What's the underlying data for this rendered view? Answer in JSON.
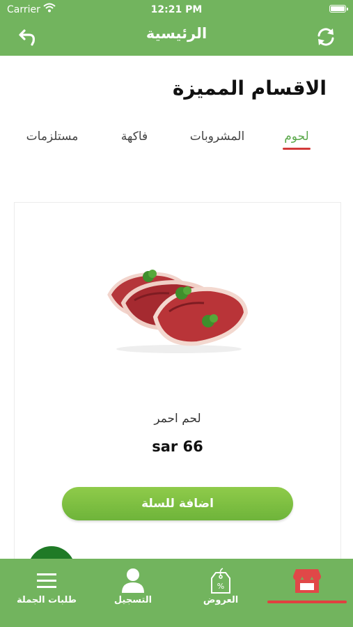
{
  "status_bar": {
    "carrier": "Carrier",
    "time": "12:21 PM"
  },
  "header": {
    "title": "الرئيسية",
    "back_icon": "back-arrow-icon",
    "refresh_icon": "refresh-icon"
  },
  "section": {
    "title": "الاقسام المميزة"
  },
  "tabs": [
    {
      "label": "لحوم",
      "active": true
    },
    {
      "label": "المشروبات",
      "active": false
    },
    {
      "label": "فاكهة",
      "active": false
    },
    {
      "label": "مستلزمات",
      "active": false
    }
  ],
  "product": {
    "name": "لحم احمر",
    "price": "sar 66",
    "add_label": "اضافة للسلة"
  },
  "tabbar": {
    "items": [
      {
        "label": "طلبات الجملة",
        "icon": "menu-icon"
      },
      {
        "label": "التسجيل",
        "icon": "user-icon"
      },
      {
        "label": "العروض",
        "icon": "offers-tag-icon"
      },
      {
        "label": "",
        "icon": "store-icon",
        "active": true
      }
    ]
  },
  "colors": {
    "primary": "#72b45e",
    "accent_red": "#d23a3a",
    "button_green": "#7cbd44",
    "fab_green": "#1f7a26"
  }
}
